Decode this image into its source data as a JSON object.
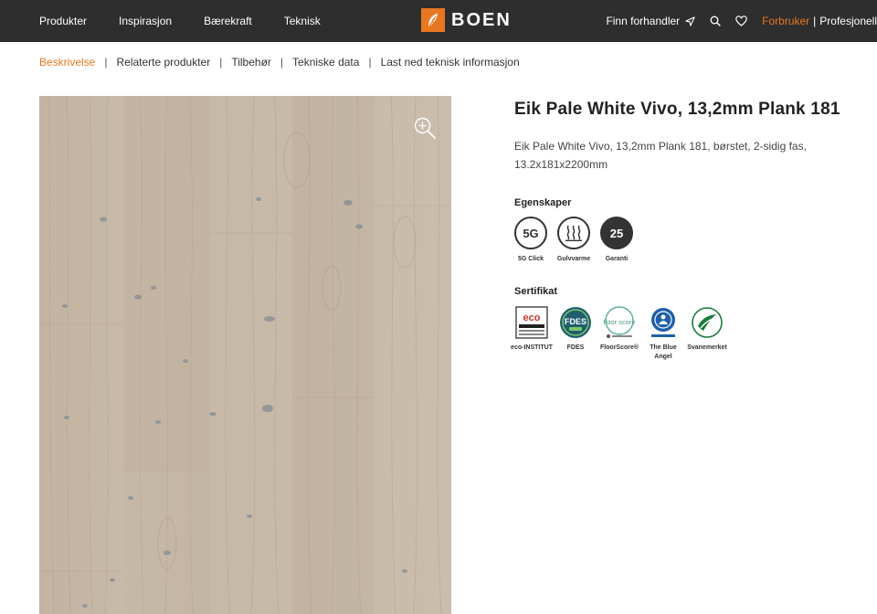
{
  "nav": {
    "items": [
      "Produkter",
      "Inspirasjon",
      "Bærekraft",
      "Teknisk"
    ],
    "logo_text": "BOEN",
    "dealer_label": "Finn forhandler",
    "consumer_label": "Forbruker",
    "separator": "|",
    "professional_label": "Profesjonell"
  },
  "subnav": {
    "tabs": [
      "Beskrivelse",
      "Relaterte produkter",
      "Tilbehør",
      "Tekniske data",
      "Last ned teknisk informasjon"
    ],
    "separator": "|"
  },
  "product": {
    "title": "Eik Pale White Vivo, 13,2mm Plank 181",
    "description": "Eik Pale White Vivo, 13,2mm Plank 181, børstet, 2-sidig fas, 13.2x181x2200mm"
  },
  "properties": {
    "heading": "Egenskaper",
    "items": [
      {
        "symbol": "5G",
        "label": "5G Click"
      },
      {
        "symbol": "",
        "label": "Gulvvarme"
      },
      {
        "symbol": "25",
        "label": "Garanti"
      }
    ]
  },
  "certificates": {
    "heading": "Sertifikat",
    "items": [
      {
        "label": "eco-INSTITUT",
        "badge_text": "eco"
      },
      {
        "label": "FDES",
        "badge_text": "FDES"
      },
      {
        "label": "FloorScore®",
        "badge_text": "floor score"
      },
      {
        "label": "The Blue Angel",
        "badge_text": ""
      },
      {
        "label": "Svanemerket",
        "badge_text": ""
      }
    ]
  },
  "colors": {
    "accent": "#e87722",
    "topbar": "#2e2e2e",
    "wood": "#c6b8a7"
  }
}
